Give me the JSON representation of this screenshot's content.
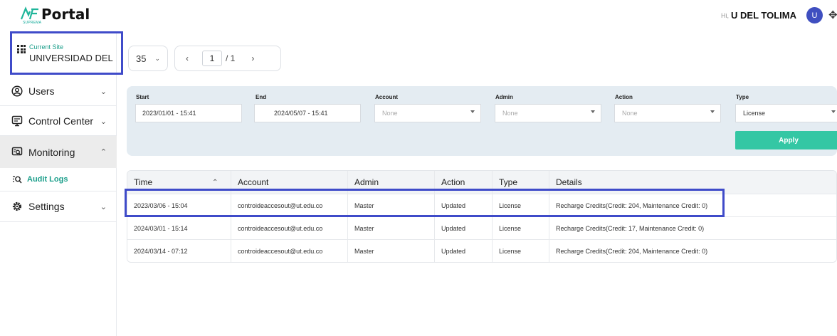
{
  "header": {
    "logo_text": "Portal",
    "logo_sub": "SUPREMA",
    "greeting": "Hi,",
    "username": "U DEL TOLIMA",
    "avatar_initial": "U"
  },
  "sidebar": {
    "site_label": "Current Site",
    "site_name": "UNIVERSIDAD DEL TOLIMA",
    "items": [
      {
        "label": "Users",
        "icon": "user-icon",
        "expanded": false
      },
      {
        "label": "Control Center",
        "icon": "monitor-icon",
        "expanded": false
      },
      {
        "label": "Monitoring",
        "icon": "monitoring-icon",
        "expanded": true
      },
      {
        "label": "Settings",
        "icon": "gear-icon",
        "expanded": false
      }
    ],
    "subitem": {
      "label": "Audit Logs",
      "icon": "search-list-icon"
    }
  },
  "pagination": {
    "page_size": "35",
    "current_page": "1",
    "total_pages": "/ 1"
  },
  "filters": {
    "start_label": "Start",
    "start_value": "2023/01/01 - 15:41",
    "end_label": "End",
    "end_value": "2024/05/07 - 15:41",
    "account_label": "Account",
    "account_value": "None",
    "admin_label": "Admin",
    "admin_value": "None",
    "action_label": "Action",
    "action_value": "None",
    "type_label": "Type",
    "type_value": "License",
    "apply_label": "Apply"
  },
  "table": {
    "headers": [
      "Time",
      "Account",
      "Admin",
      "Action",
      "Type",
      "Details"
    ],
    "rows": [
      [
        "2023/03/06 - 15:04",
        "controideaccesout@ut.edu.co",
        "Master",
        "Updated",
        "License",
        "Recharge Credits(Credit: 204, Maintenance Credit: 0)"
      ],
      [
        "2024/03/01 - 15:14",
        "controideaccesout@ut.edu.co",
        "Master",
        "Updated",
        "License",
        "Recharge Credits(Credit: 17, Maintenance Credit: 0)"
      ],
      [
        "2024/03/14 - 07:12",
        "controideaccesout@ut.edu.co",
        "Master",
        "Updated",
        "License",
        "Recharge Credits(Credit: 204, Maintenance Credit: 0)"
      ]
    ]
  },
  "colors": {
    "accent": "#1a9e8a",
    "apply": "#34c7a4",
    "highlight": "#3f4bc9",
    "avatar": "#3f4fc0"
  }
}
